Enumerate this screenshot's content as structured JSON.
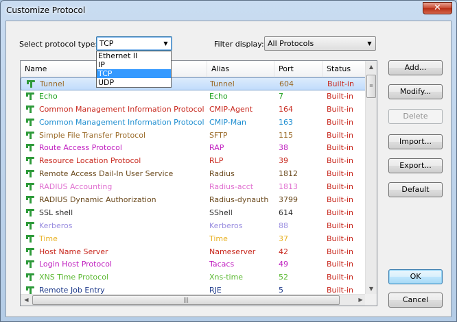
{
  "window": {
    "title": "Customize Protocol",
    "close_glyph": "✕"
  },
  "form": {
    "protocol_type_label": "Select protocol type:",
    "protocol_type_value": "TCP",
    "protocol_type_options": [
      "Ethernet II",
      "IP",
      "TCP",
      "UDP"
    ],
    "filter_label": "Filter display:",
    "filter_value": "All Protocols"
  },
  "table": {
    "columns": [
      "Name",
      "Alias",
      "Port",
      "Status"
    ],
    "rows": [
      {
        "name": "Tunnel",
        "alias": "Tunnel",
        "port": "604",
        "status": "Built-in",
        "color": "#9a6a28"
      },
      {
        "name": "Echo",
        "alias": "Echo",
        "port": "7",
        "status": "Built-in",
        "color": "#1aa01a"
      },
      {
        "name": "Common Management Information Protocol Ag...",
        "alias": "CMIP-Agent",
        "port": "164",
        "status": "Built-in",
        "color": "#c8281e"
      },
      {
        "name": "Common Management Information Protocol Man",
        "alias": "CMIP-Man",
        "port": "163",
        "status": "Built-in",
        "color": "#1e8ed0"
      },
      {
        "name": "Simple File Transfer Protocol",
        "alias": "SFTP",
        "port": "115",
        "status": "Built-in",
        "color": "#9a6a28"
      },
      {
        "name": "Route Access Protocol",
        "alias": "RAP",
        "port": "38",
        "status": "Built-in",
        "color": "#c01ec0"
      },
      {
        "name": "Resource Location Protocol",
        "alias": "RLP",
        "port": "39",
        "status": "Built-in",
        "color": "#c8281e"
      },
      {
        "name": "Remote Access Dail-In User Service",
        "alias": "Radius",
        "port": "1812",
        "status": "Built-in",
        "color": "#6b4a1e"
      },
      {
        "name": "RADIUS Accounting",
        "alias": "Radius-acct",
        "port": "1813",
        "status": "Built-in",
        "color": "#e070d0"
      },
      {
        "name": "RADIUS Dynamic Authorization",
        "alias": "Radius-dynauth",
        "port": "3799",
        "status": "Built-in",
        "color": "#6b4a1e"
      },
      {
        "name": "SSL shell",
        "alias": "SShell",
        "port": "614",
        "status": "Built-in",
        "color": "#303030"
      },
      {
        "name": "Kerberos",
        "alias": "Kerberos",
        "port": "88",
        "status": "Built-in",
        "color": "#9a8ee0"
      },
      {
        "name": "Time",
        "alias": "Time",
        "port": "37",
        "status": "Built-in",
        "color": "#e8b020"
      },
      {
        "name": "Host Name Server",
        "alias": "Nameserver",
        "port": "42",
        "status": "Built-in",
        "color": "#c8281e"
      },
      {
        "name": "Login Host Protocol",
        "alias": "Tacacs",
        "port": "49",
        "status": "Built-in",
        "color": "#c01ec0"
      },
      {
        "name": "XNS Time Protocol",
        "alias": "Xns-time",
        "port": "52",
        "status": "Built-in",
        "color": "#5ab830"
      },
      {
        "name": "Remote Job Entry",
        "alias": "RJE",
        "port": "5",
        "status": "Built-in",
        "color": "#1e3a8a"
      }
    ]
  },
  "buttons": {
    "add": "Add...",
    "modify": "Modify...",
    "delete": "Delete",
    "import": "Import...",
    "export": "Export...",
    "default": "Default",
    "ok": "OK",
    "cancel": "Cancel"
  },
  "icons": {
    "protocol": "protocol-tree-icon",
    "scroll_up": "▲",
    "scroll_down": "▼",
    "scroll_left": "◀",
    "scroll_right": "▶",
    "dropdown": "▼",
    "grip": "≡",
    "hgrip": "|||"
  }
}
